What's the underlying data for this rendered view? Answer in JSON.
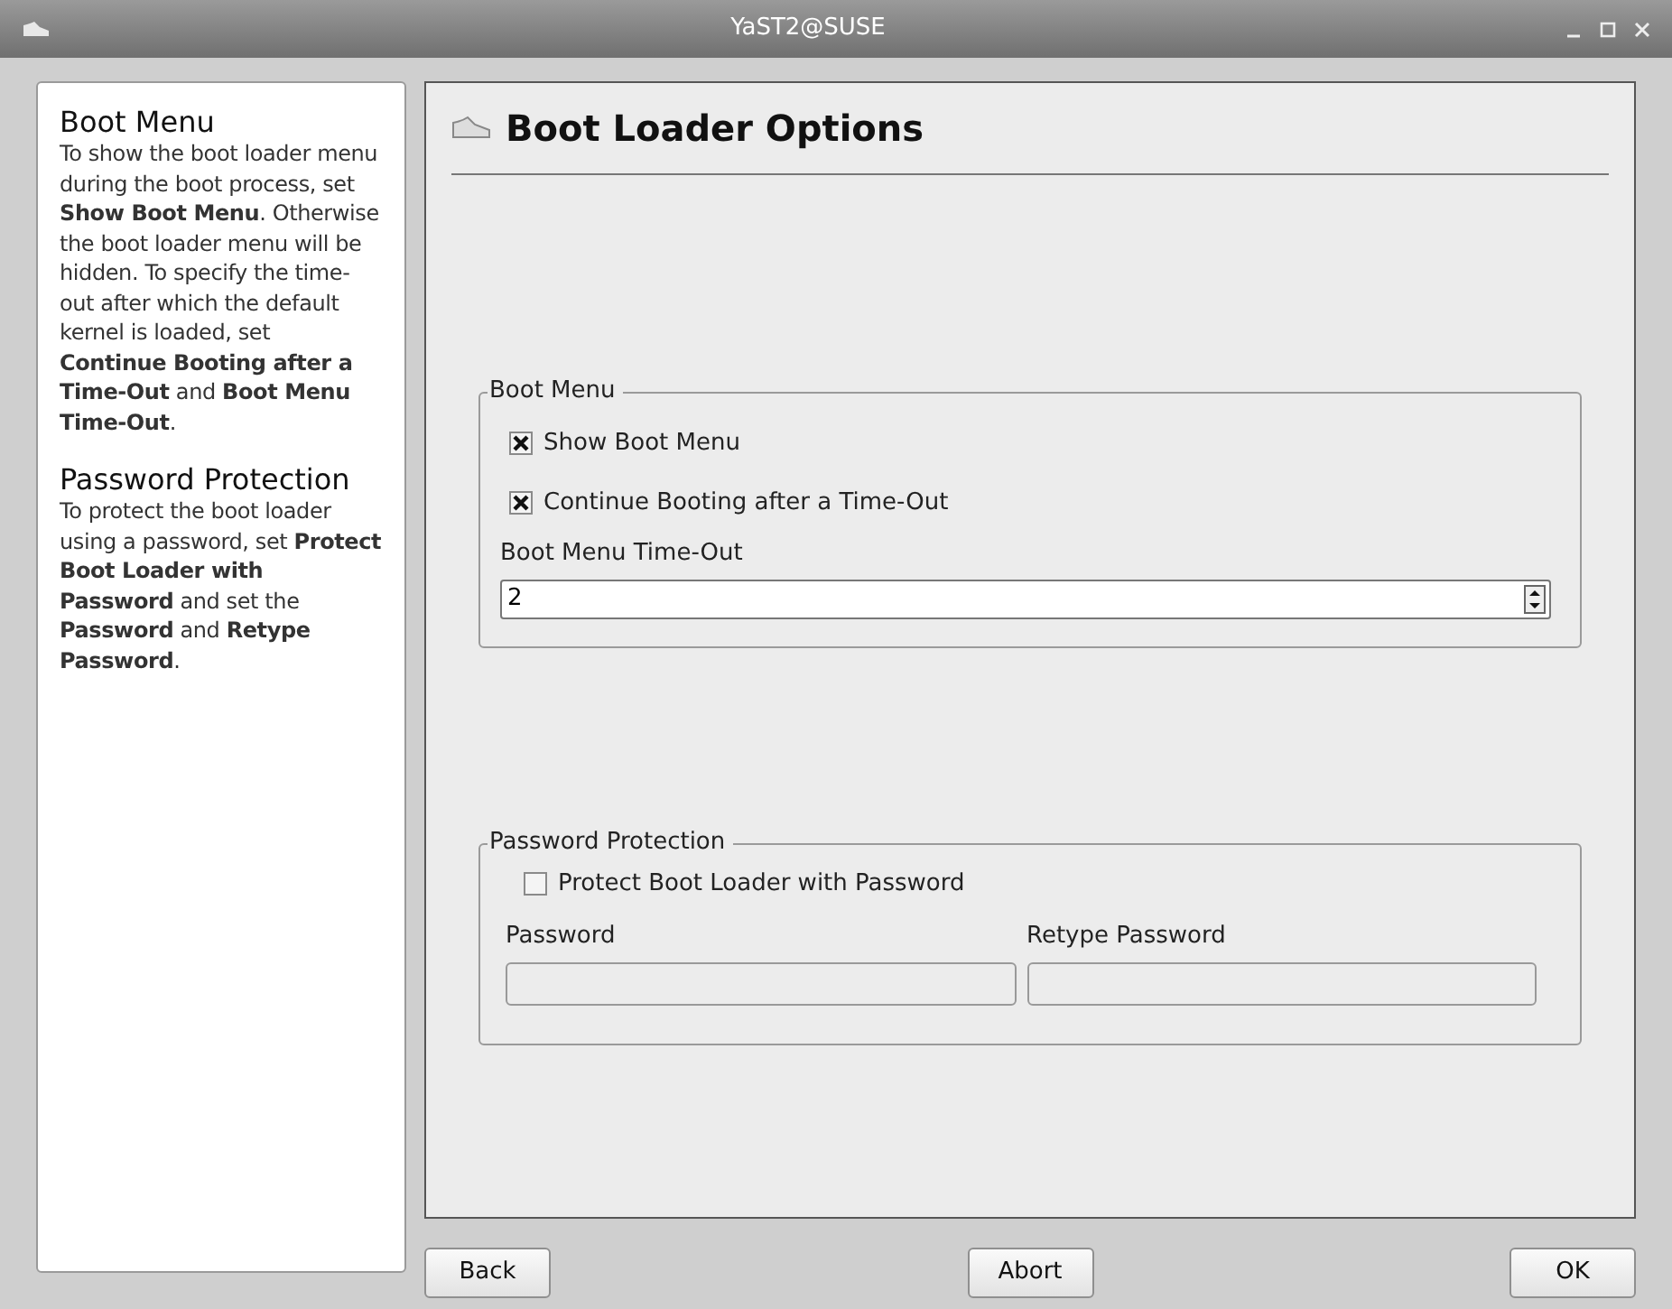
{
  "window": {
    "title": "YaST2@SUSE"
  },
  "help": [
    {
      "title": "Boot Menu",
      "text": "To show the boot loader menu during the boot process, set **Show Boot Menu**. Otherwise the boot loader menu will be hidden. To specify the time-out after which the default kernel is loaded, set **Continue Booting after a Time-Out** and **Boot Menu Time-Out**."
    },
    {
      "title": "Password Protection",
      "text": "To protect the boot loader using a password, set **Protect Boot Loader with Password** and set the **Password** and **Retype Password**."
    }
  ],
  "heading": "Boot Loader Options",
  "boot_menu": {
    "title": "Boot Menu",
    "checkboxes": [
      {
        "label": "Show Boot Menu",
        "checked": true
      },
      {
        "label": "Continue Booting after a Time-Out",
        "checked": true
      }
    ],
    "timeout": {
      "label": "Boot Menu Time-Out",
      "value": "2"
    }
  },
  "password_protection": {
    "title": "Password Protection",
    "checkbox": {
      "label": "Protect Boot Loader with Password",
      "checked": false
    },
    "fields": [
      {
        "label": "Password",
        "disabled": true
      },
      {
        "label": "Retype Password",
        "disabled": true
      }
    ]
  },
  "buttons": [
    "Back",
    "Abort",
    "OK"
  ]
}
